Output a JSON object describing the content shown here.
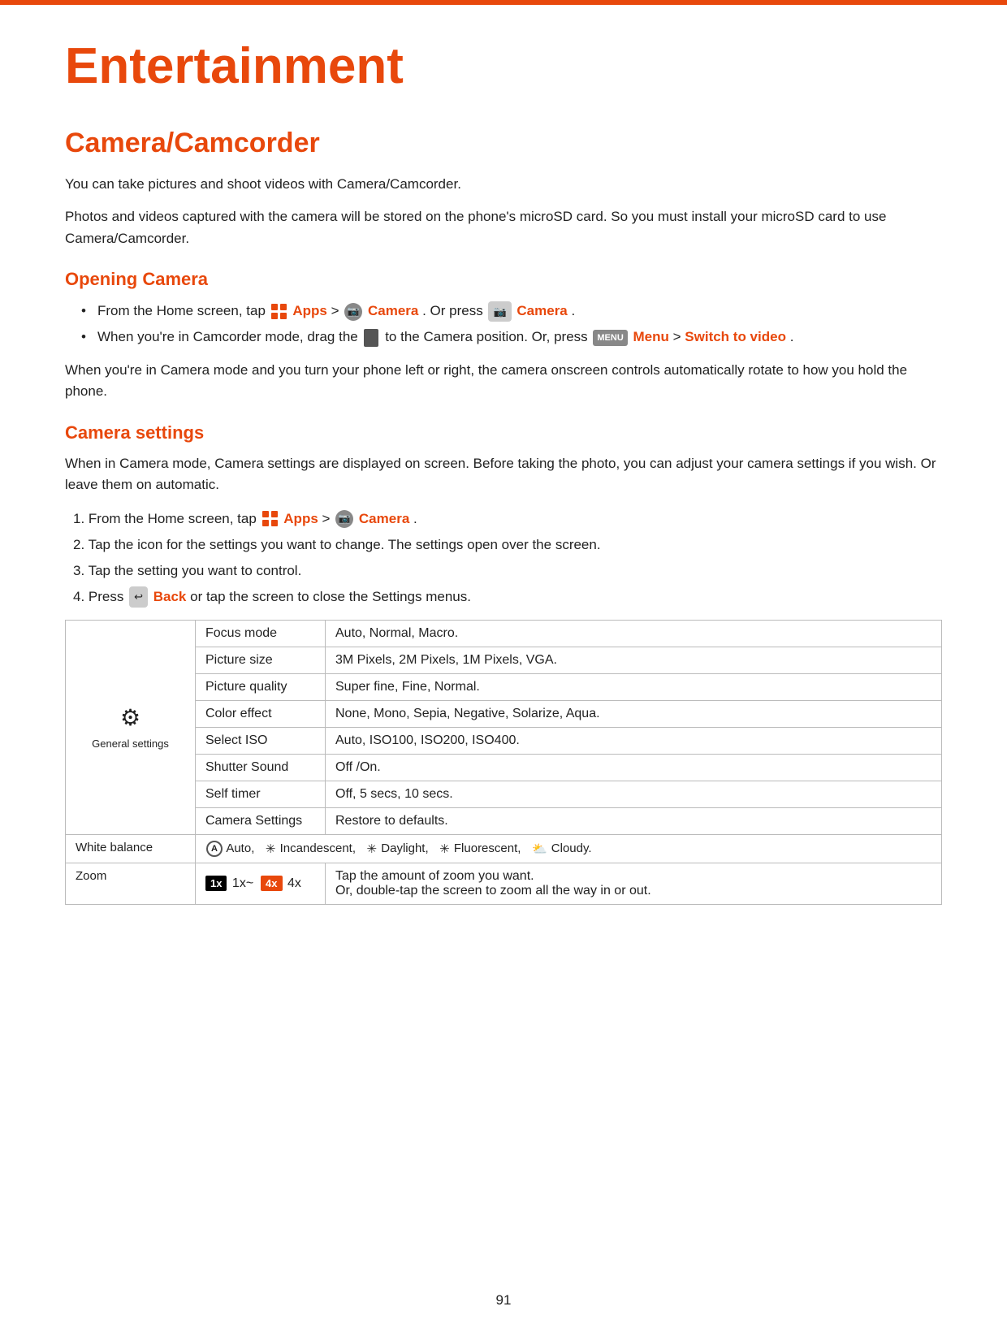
{
  "page": {
    "top_border_color": "#e8480c",
    "title": "Entertainment",
    "footer_page_number": "91"
  },
  "camera_section": {
    "title": "Camera/Camcorder",
    "intro_1": "You can take pictures and shoot videos with Camera/Camcorder.",
    "intro_2": "Photos and videos captured with the camera will be stored on the phone's microSD card. So you must install your microSD card to use Camera/Camcorder.",
    "opening_camera": {
      "title": "Opening Camera",
      "bullet_1_prefix": "From the Home screen, tap ",
      "bullet_1_apps": "Apps",
      "bullet_1_mid": " > ",
      "bullet_1_camera": "Camera",
      "bullet_1_suffix": ". Or press ",
      "bullet_1_camera2": "Camera",
      "bullet_1_end": ".",
      "bullet_2_prefix": "When you're in Camcorder mode, drag the ",
      "bullet_2_suffix": " to the Camera position. Or, press ",
      "bullet_2_menu": "Menu",
      "bullet_2_mid": " > ",
      "bullet_2_switch": "Switch to video",
      "bullet_2_end": "."
    },
    "rotate_text": "When you're in Camera mode and you turn your phone left or right, the camera onscreen controls automatically rotate to how you hold the phone.",
    "camera_settings": {
      "title": "Camera settings",
      "intro": "When in Camera mode, Camera settings are displayed on screen. Before taking the photo, you can adjust your camera settings if you wish. Or leave them on automatic.",
      "step1_prefix": "1. From the Home screen, tap ",
      "step1_apps": "Apps",
      "step1_mid": " > ",
      "step1_camera": "Camera",
      "step1_end": ".",
      "step2": "2. Tap the icon for the settings you want to change. The settings open over the screen.",
      "step3": "3. Tap the setting you want to control.",
      "step4_prefix": "4. Press ",
      "step4_back": "Back",
      "step4_suffix": " or tap the screen to close the Settings menus.",
      "table": {
        "rows": [
          {
            "group": "General settings",
            "setting": "Focus mode",
            "value": "Auto, Normal, Macro."
          },
          {
            "group": "",
            "setting": "Picture size",
            "value": "3M Pixels, 2M Pixels, 1M Pixels, VGA."
          },
          {
            "group": "",
            "setting": "Picture quality",
            "value": "Super fine, Fine, Normal."
          },
          {
            "group": "",
            "setting": "Color effect",
            "value": "None, Mono, Sepia, Negative, Solarize, Aqua."
          },
          {
            "group": "",
            "setting": "Select ISO",
            "value": "Auto, ISO100, ISO200, ISO400."
          },
          {
            "group": "",
            "setting": "Shutter Sound",
            "value": "Off /On."
          },
          {
            "group": "",
            "setting": "Self timer",
            "value": "Off, 5 secs, 10 secs."
          },
          {
            "group": "",
            "setting": "Camera Settings",
            "value": "Restore to defaults."
          }
        ],
        "white_balance_label": "White balance",
        "white_balance_value": "Auto,   Incandescent,   Daylight,   Fluorescent,   Cloudy.",
        "zoom_label": "Zoom",
        "zoom_line1": "Tap the amount of zoom you want.",
        "zoom_line2": "Or, double-tap the screen to zoom all the way in or out."
      }
    }
  }
}
